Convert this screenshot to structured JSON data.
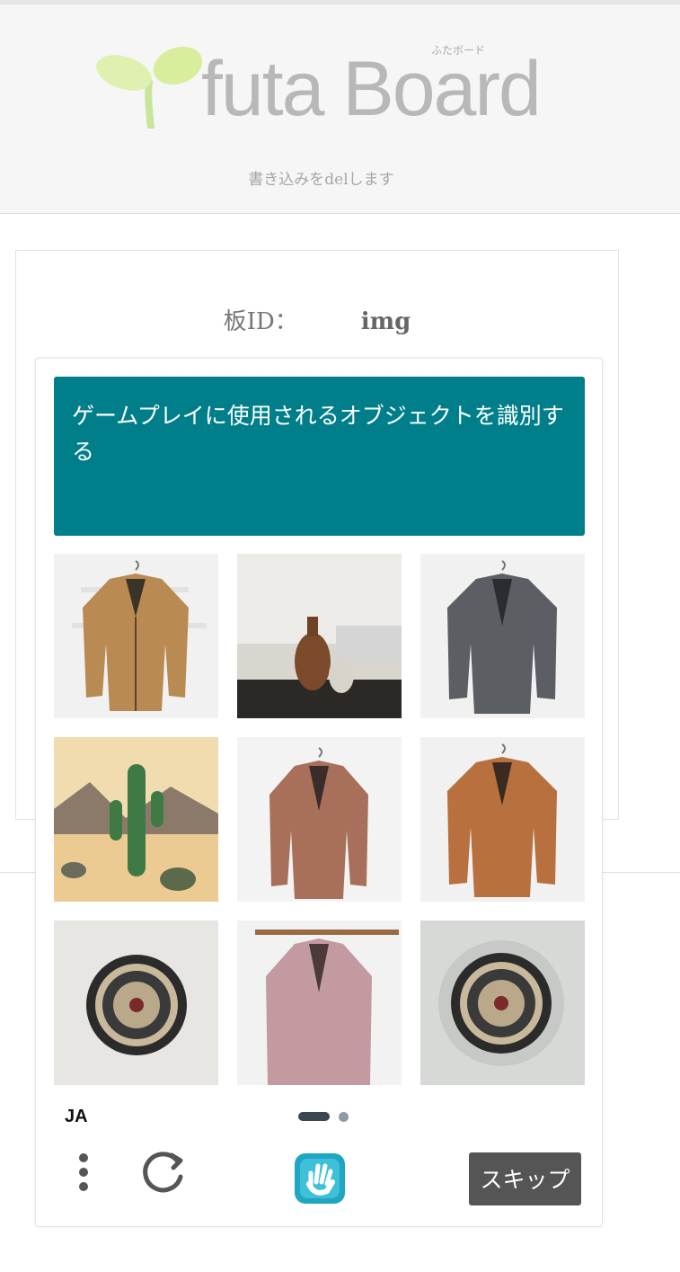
{
  "header": {
    "logo_text": "futa Board",
    "logo_kana": "ふたボード",
    "subtitle": "書き込みをdelします"
  },
  "form": {
    "board_label": "板ID：",
    "board_value": "img"
  },
  "captcha": {
    "prompt": "ゲームプレイに使用されるオブジェクトを識別する",
    "tiles": [
      {
        "name": "tile-leather-jacket-plaid"
      },
      {
        "name": "tile-vases-living-room"
      },
      {
        "name": "tile-leather-jacket-dark"
      },
      {
        "name": "tile-cactus-desert"
      },
      {
        "name": "tile-leather-jacket-copper"
      },
      {
        "name": "tile-leather-jacket-orange"
      },
      {
        "name": "tile-dartboard-1"
      },
      {
        "name": "tile-leather-jacket-pink"
      },
      {
        "name": "tile-dartboard-2"
      }
    ],
    "language": "JA",
    "page_current": 1,
    "page_total": 2,
    "skip_label": "スキップ",
    "icons": {
      "menu": "vertical-dots-icon",
      "refresh": "refresh-icon",
      "logo": "hcaptcha-hand-icon"
    },
    "colors": {
      "prompt_bg": "#007f8a",
      "skip_bg": "#555555"
    }
  }
}
